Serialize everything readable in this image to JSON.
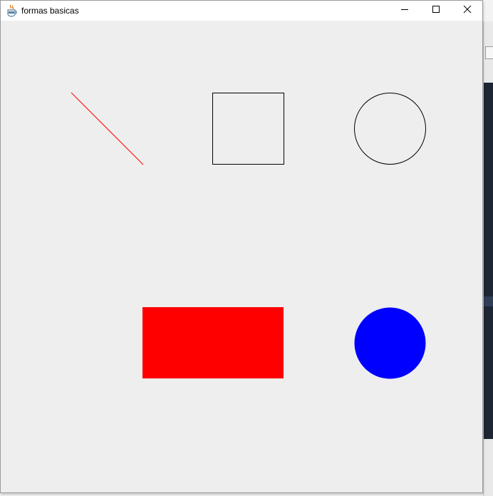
{
  "window": {
    "title": "formas basicas",
    "app_icon": "java-cup-icon",
    "controls": {
      "minimize_icon": "minimize-icon",
      "maximize_icon": "maximize-icon",
      "close_icon": "close-icon"
    }
  },
  "shapes": [
    {
      "kind": "line",
      "name": "red-diagonal-line",
      "stroke": "#ff0000",
      "fill": "none"
    },
    {
      "kind": "square-outline",
      "name": "black-outline-square",
      "stroke": "#000000",
      "fill": "none"
    },
    {
      "kind": "circle-outline",
      "name": "black-outline-circle",
      "stroke": "#000000",
      "fill": "none"
    },
    {
      "kind": "filled-rectangle",
      "name": "red-filled-rectangle",
      "stroke": "none",
      "fill": "#ff0000"
    },
    {
      "kind": "filled-circle",
      "name": "blue-filled-circle",
      "stroke": "none",
      "fill": "#0000ff"
    }
  ],
  "colors": {
    "canvas_background": "#eeeeee",
    "titlebar_background": "#ffffff"
  }
}
